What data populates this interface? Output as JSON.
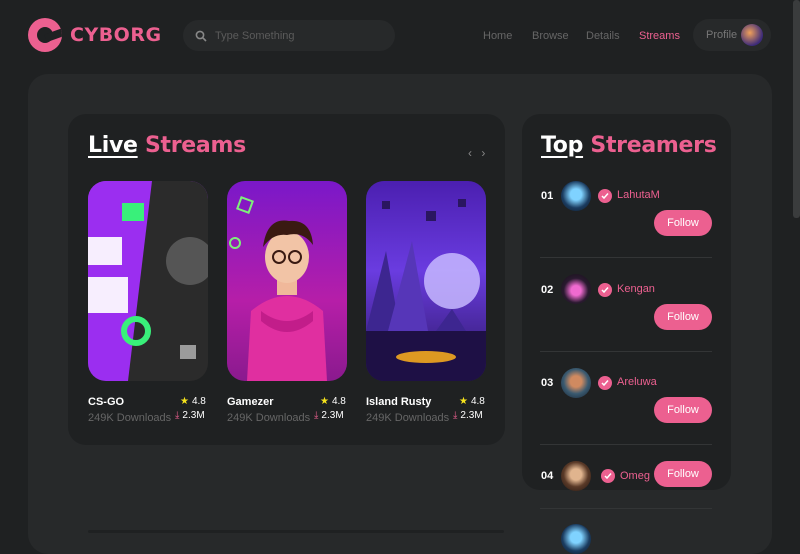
{
  "header": {
    "brand": "CYBORG",
    "search_placeholder": "Type Something",
    "nav": [
      "Home",
      "Browse",
      "Details",
      "Streams"
    ],
    "active_nav": "Streams",
    "profile_label": "Profile"
  },
  "live_streams": {
    "title_white": "Live",
    "title_pink": "Streams",
    "arrows": "‹ ›",
    "cards": [
      {
        "title": "CS-GO",
        "rating": "4.8",
        "subtitle": "249K Downloads",
        "downloads": "2.3M"
      },
      {
        "title": "Gamezer",
        "rating": "4.8",
        "subtitle": "249K Downloads",
        "downloads": "2.3M"
      },
      {
        "title": "Island Rusty",
        "rating": "4.8",
        "subtitle": "249K Downloads",
        "downloads": "2.3M"
      }
    ]
  },
  "top_streamers": {
    "title_white": "Top",
    "title_pink": "Streamers",
    "items": [
      {
        "rank": "01",
        "name": "LahutaM",
        "action": "Follow"
      },
      {
        "rank": "02",
        "name": "Kengan",
        "action": "Follow"
      },
      {
        "rank": "03",
        "name": "Areluwa",
        "action": "Follow"
      },
      {
        "rank": "04",
        "name": "Omeg",
        "action": "Follow"
      }
    ]
  },
  "colors": {
    "accent": "#ec6090",
    "background": "#1f2122",
    "panel": "#27292a"
  }
}
